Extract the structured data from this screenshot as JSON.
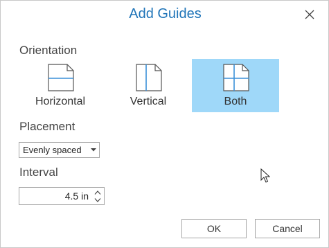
{
  "dialog": {
    "title": "Add Guides",
    "close_icon": "close-icon"
  },
  "orientation": {
    "label": "Orientation",
    "options": [
      {
        "label": "Horizontal",
        "icon": "horizontal-guide-icon",
        "selected": false
      },
      {
        "label": "Vertical",
        "icon": "vertical-guide-icon",
        "selected": false
      },
      {
        "label": "Both",
        "icon": "both-guides-icon",
        "selected": true
      }
    ],
    "selected_color": "#9fd8f9"
  },
  "placement": {
    "label": "Placement",
    "value": "Evenly spaced"
  },
  "interval": {
    "label": "Interval",
    "value": "4.5 in"
  },
  "buttons": {
    "ok": "OK",
    "cancel": "Cancel"
  },
  "colors": {
    "title": "#1f74b8",
    "guide_line": "#3a8fd9"
  }
}
